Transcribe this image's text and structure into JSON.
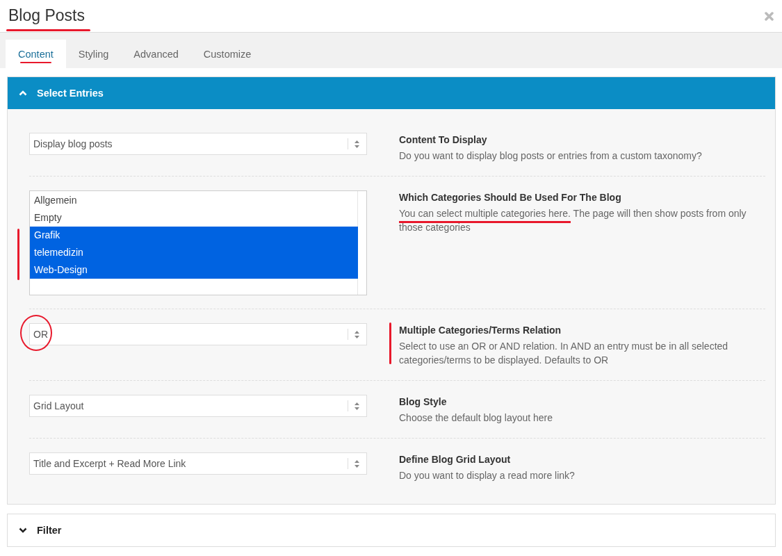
{
  "window": {
    "title": "Blog Posts",
    "title_underlined": true
  },
  "tabs": [
    {
      "label": "Content",
      "selected": true,
      "underlined": true
    },
    {
      "label": "Styling",
      "selected": false,
      "underlined": false
    },
    {
      "label": "Advanced",
      "selected": false,
      "underlined": false
    },
    {
      "label": "Customize",
      "selected": false,
      "underlined": false
    }
  ],
  "panels": [
    {
      "title": "Select Entries",
      "expanded": true,
      "rows": [
        {
          "field": {
            "kind": "select",
            "value": "Display blog posts"
          },
          "label": "Content To Display",
          "description": [
            {
              "text": "Do you want to display blog posts or entries from a custom taxonomy?"
            }
          ]
        },
        {
          "field": {
            "kind": "listbox",
            "side_line": true,
            "options": [
              {
                "label": "Allgemein",
                "selected": false
              },
              {
                "label": "Empty",
                "selected": false
              },
              {
                "label": "Grafik",
                "selected": true
              },
              {
                "label": "telemedizin",
                "selected": true
              },
              {
                "label": "Web-Design",
                "selected": true
              }
            ]
          },
          "label": "Which Categories Should Be Used For The Blog",
          "description": [
            {
              "text": "You can select multiple categories here.",
              "underlined": true
            },
            {
              "text": " The page will then show posts from only those categories"
            }
          ]
        },
        {
          "field": {
            "kind": "select",
            "value": "OR",
            "circled": true
          },
          "label": "Multiple Categories/Terms Relation",
          "side_line": true,
          "description": [
            {
              "text": "Select to use an OR or AND relation. In AND an entry must be in all selected categories/terms to be displayed. Defaults to OR"
            }
          ]
        },
        {
          "field": {
            "kind": "select",
            "value": "Grid Layout"
          },
          "label": "Blog Style",
          "description": [
            {
              "text": "Choose the default blog layout here"
            }
          ]
        },
        {
          "field": {
            "kind": "select",
            "value": "Title and Excerpt + Read More Link"
          },
          "label": "Define Blog Grid Layout",
          "description": [
            {
              "text": "Do you want to display a read more link?"
            }
          ]
        }
      ]
    },
    {
      "title": "Filter",
      "expanded": false
    }
  ]
}
